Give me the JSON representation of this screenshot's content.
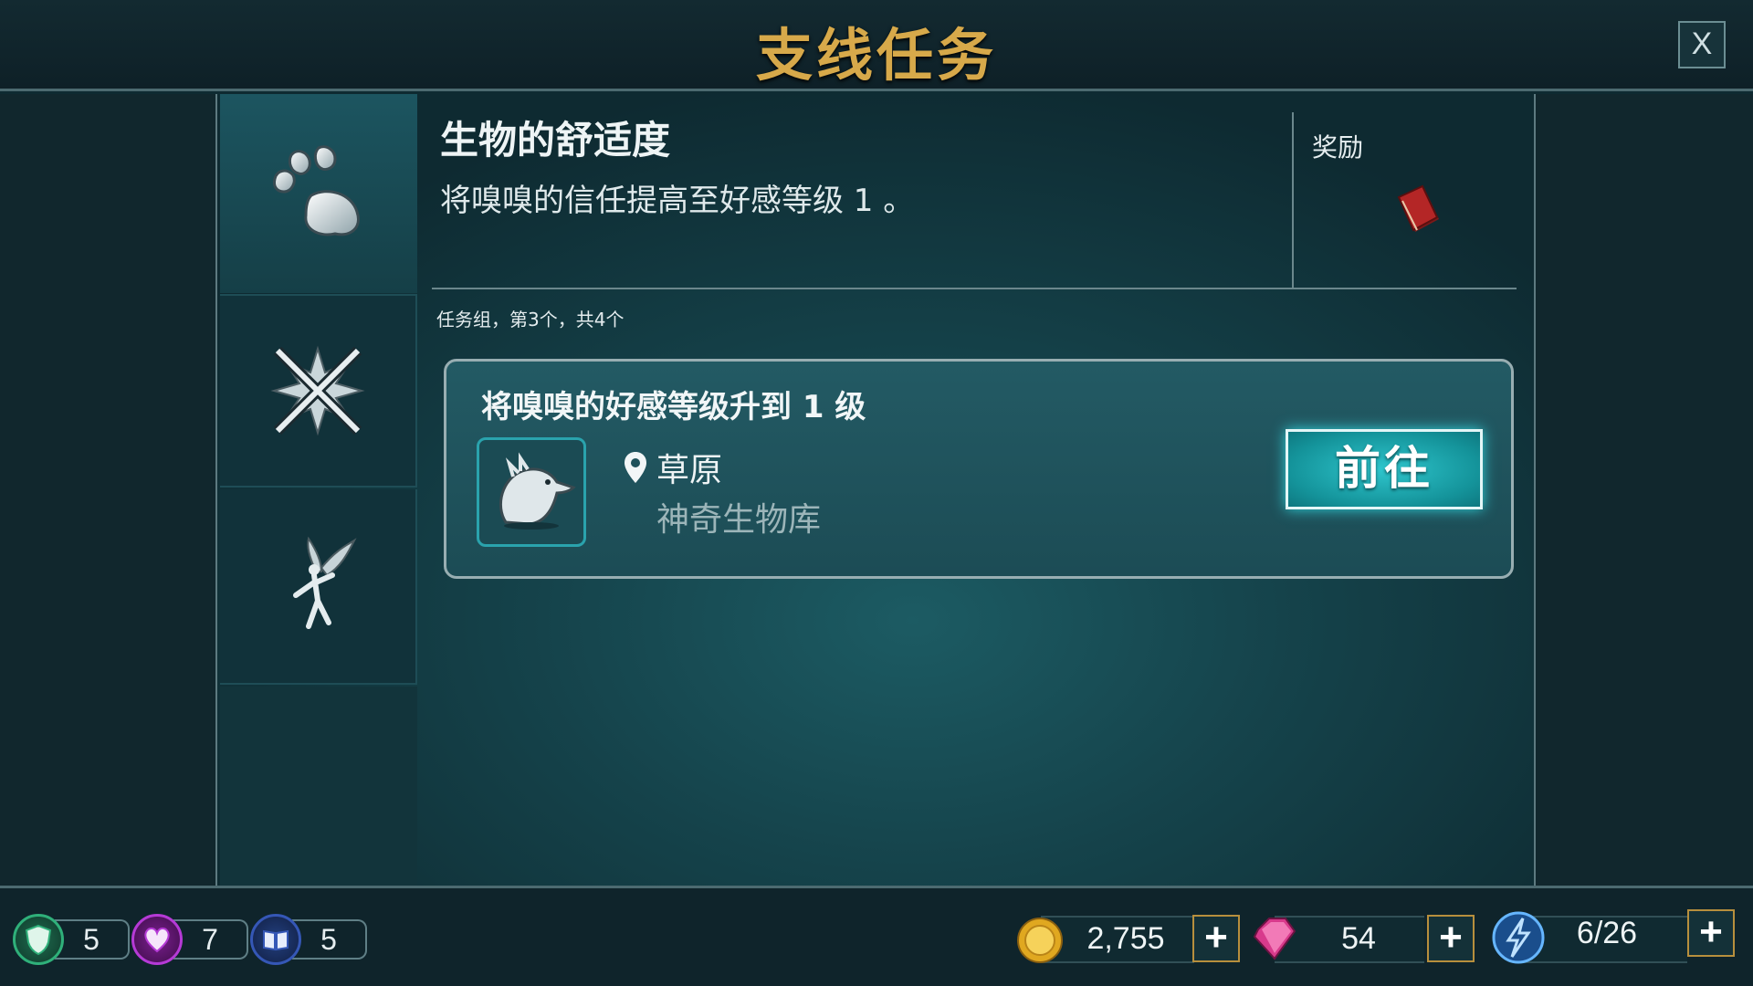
{
  "header": {
    "title": "支线任务",
    "close_label": "X"
  },
  "quest": {
    "name": "生物的舒适度",
    "description": "将嗅嗅的信任提高至好感等级 1 。",
    "reward_label": "奖励",
    "reward_icon": "red-book-icon",
    "group_info": "任务组，第3个，共4个"
  },
  "categories": [
    {
      "icon": "paw-icon",
      "selected": true
    },
    {
      "icon": "crossed-wands-icon",
      "selected": false
    },
    {
      "icon": "pixie-icon",
      "selected": false
    }
  ],
  "task": {
    "title": "将嗅嗅的好感等级升到 1 级",
    "creature_icon": "niffler-icon",
    "location": "草原",
    "sublocation": "神奇生物库",
    "go_label": "前往"
  },
  "stats": [
    {
      "icon": "shield-icon",
      "value": "5",
      "color": "#2fb07a"
    },
    {
      "icon": "heart-icon",
      "value": "7",
      "color": "#b53ad6"
    },
    {
      "icon": "book-icon",
      "value": "5",
      "color": "#3557b6"
    }
  ],
  "currency": {
    "coins": "2,755",
    "gems": "54",
    "energy": "6/26"
  },
  "colors": {
    "title_gold": "#d7a94a",
    "accent_teal": "#2fc6cd"
  }
}
